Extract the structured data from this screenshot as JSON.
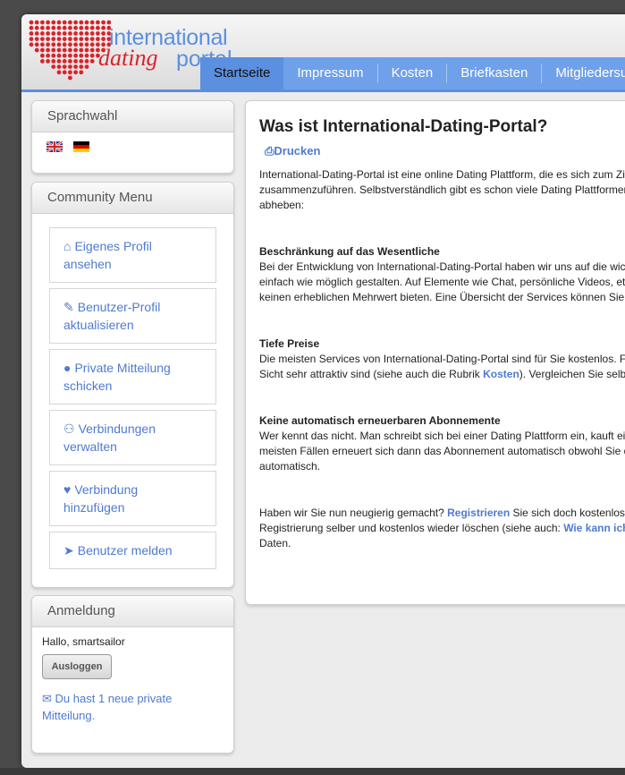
{
  "logo": {
    "line1": "international",
    "line2a": "dating",
    "line2b": "portal"
  },
  "nav": [
    "Startseite",
    "Impressum",
    "Kosten",
    "Briefkasten",
    "Mitgliedersuche"
  ],
  "sidebar": {
    "language": {
      "title": "Sprachwahl",
      "flags": [
        "uk-flag",
        "germany-flag"
      ]
    },
    "community": {
      "title": "Community Menu",
      "items": [
        {
          "icon": "home-icon",
          "label": "Eigenes Profil ansehen"
        },
        {
          "icon": "edit-icon",
          "label": "Benutzer-Profil aktualisieren"
        },
        {
          "icon": "chat-icon",
          "label": "Private Mitteilung schicken"
        },
        {
          "icon": "users-icon",
          "label": "Verbindungen verwalten"
        },
        {
          "icon": "heart-icon",
          "label": "Verbindung hinzufügen"
        },
        {
          "icon": "megaphone-icon",
          "label": "Benutzer melden"
        }
      ]
    },
    "login": {
      "title": "Anmeldung",
      "greeting": "Hallo, smartsailor",
      "logout": "Ausloggen",
      "message": "Du hast 1 neue private Mitteilung."
    }
  },
  "content": {
    "title": "Was ist International-Dating-Portal?",
    "print": "Drucken",
    "intro": [
      "International-Dating-Portal ist eine online Dating Plattform, die es sich zum Ziel gesetzt hat,",
      "zusammenzuführen. Selbstverständlich gibt es schon viele Dating Plattformen im Internet",
      "abheben:"
    ],
    "s1": {
      "title": "Beschränkung auf das Wesentliche",
      "lines": [
        "Bei der Entwicklung von International-Dating-Portal haben wir uns auf die wichtigsten",
        "einfach wie möglich gestalten. Auf Elemente wie Chat, persönliche Videos, etc. haben",
        "keinen erheblichen Mehrwert bieten. Eine Übersicht der Services können Sie der"
      ]
    },
    "s2": {
      "title": "Tiefe Preise",
      "line1": "Die meisten Services von International-Dating-Portal sind für Sie kostenlos. Für einige",
      "line2a": "Sicht sehr attraktiv sind (siehe auch die Rubrik ",
      "line2link": "Kosten",
      "line2b": "). Vergleichen Sie selbst."
    },
    "s3": {
      "title": "Keine automatisch erneuerbaren Abonnemente",
      "lines": [
        "Wer kennt das nicht. Man schreibt sich bei einer Dating Plattform ein, kauft ein Abonnement",
        "meisten Fällen erneuert sich dann das Abonnement automatisch obwohl Sie dies",
        "automatisch."
      ]
    },
    "closing": {
      "a": "Haben wir Sie nun neugierig gemacht? ",
      "link1": "Registrieren",
      "b": " Sie sich doch kostenlos und",
      "c": "Registrierung selber und kostenlos wieder löschen (siehe auch: ",
      "link2": "Wie kann ich mich abmelden?",
      "d": "Daten."
    }
  }
}
